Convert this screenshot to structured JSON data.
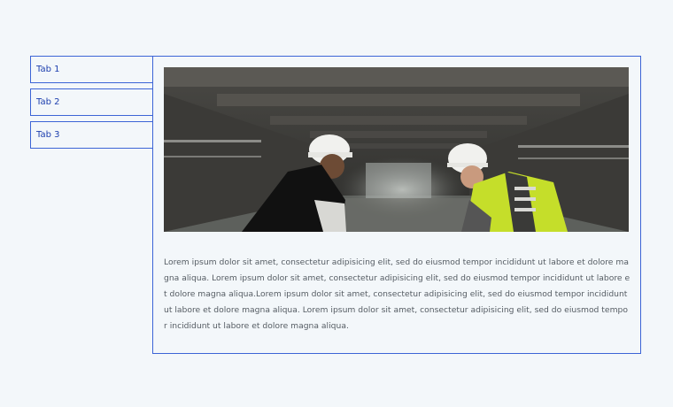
{
  "tabs": [
    {
      "label": "Tab 1",
      "active": true
    },
    {
      "label": "Tab 2",
      "active": false
    },
    {
      "label": "Tab 3",
      "active": false
    }
  ],
  "panel": {
    "image_alt": "Two construction workers in hard hats in a parking garage",
    "text": "Lorem ipsum dolor sit amet, consectetur adipisicing elit, sed do eiusmod tempor incididunt ut labore et dolore magna aliqua. Lorem ipsum dolor sit amet, consectetur adipisicing elit, sed do eiusmod tempor incididunt ut labore et dolore magna aliqua.Lorem ipsum dolor sit amet, consectetur adipisicing elit, sed do eiusmod tempor incididunt ut labore et dolore magna aliqua. Lorem ipsum dolor sit amet, consectetur adipisicing elit, sed do eiusmod tempor incididunt ut labore et dolore magna aliqua."
  },
  "colors": {
    "accent": "#3c64d6",
    "tab_text": "#1d3fae",
    "background": "#f3f7fa",
    "body_text": "#555c63"
  }
}
